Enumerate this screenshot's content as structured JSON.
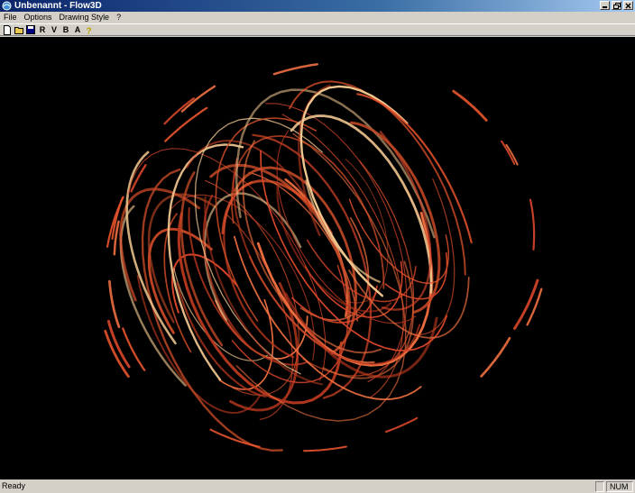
{
  "window": {
    "title": "Unbenannt - Flow3D",
    "icon": "flow3d-app-icon",
    "buttons": [
      "minimize-icon",
      "restore-icon",
      "close-icon"
    ]
  },
  "menu": {
    "items": [
      {
        "label": "File"
      },
      {
        "label": "Options"
      },
      {
        "label": "Drawing Style"
      },
      {
        "label": "?"
      }
    ]
  },
  "toolbar": {
    "buttons": [
      {
        "icon": "new-file-icon",
        "label": ""
      },
      {
        "icon": "open-folder-icon",
        "label": ""
      },
      {
        "icon": "save-disk-icon",
        "label": ""
      },
      {
        "icon": "",
        "label": "R"
      },
      {
        "icon": "",
        "label": "V"
      },
      {
        "icon": "",
        "label": "B"
      },
      {
        "icon": "",
        "label": "A"
      },
      {
        "icon": "help-icon",
        "label": ""
      }
    ]
  },
  "viewport": {
    "background": "#000000",
    "stroke_colors": [
      "#e8542c",
      "#d8462a",
      "#f07040",
      "#b8381e",
      "#f2c890",
      "#c44a26"
    ]
  },
  "status": {
    "text": "Ready",
    "indicator": "NUM"
  }
}
